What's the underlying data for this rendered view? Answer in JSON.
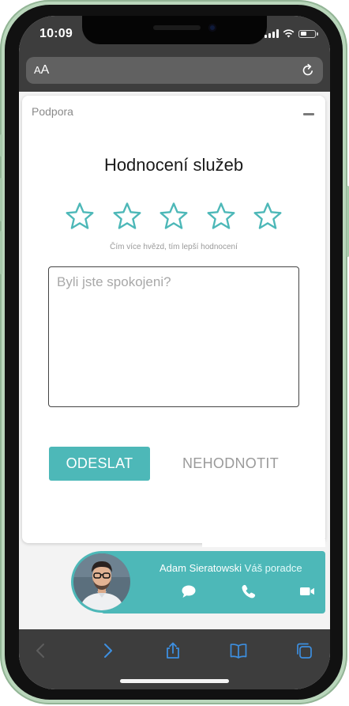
{
  "status_bar": {
    "time": "10:09"
  },
  "browser": {
    "text_size_label_small": "A",
    "text_size_label_big": "A"
  },
  "widget": {
    "header_title": "Podpora",
    "rating_title": "Hodnocení služeb",
    "star_count": 5,
    "rating_value": 0,
    "rating_hint": "Čím více hvězd, tím lepší hodnocení",
    "feedback_placeholder": "Byli jste spokojeni?",
    "feedback_value": "",
    "submit_label": "ODESLAT",
    "skip_label": "NEHODNOTIT"
  },
  "advisor": {
    "name": "Adam Sieratowski",
    "role": "Váš poradce"
  },
  "colors": {
    "accent": "#4db8b8",
    "frame": "#b9d6bb",
    "chrome": "#3d3d3d",
    "toolbar_active": "#3d8fe0",
    "toolbar_disabled": "#5d5d5d"
  },
  "icons": {
    "stars": "star-outline-icon",
    "reload": "reload-icon",
    "chat": "chat-bubble-icon",
    "phone": "phone-icon",
    "video": "video-camera-icon",
    "toolbar": [
      "back-arrow-icon",
      "forward-arrow-icon",
      "share-icon",
      "bookmarks-icon",
      "tabs-icon"
    ]
  }
}
